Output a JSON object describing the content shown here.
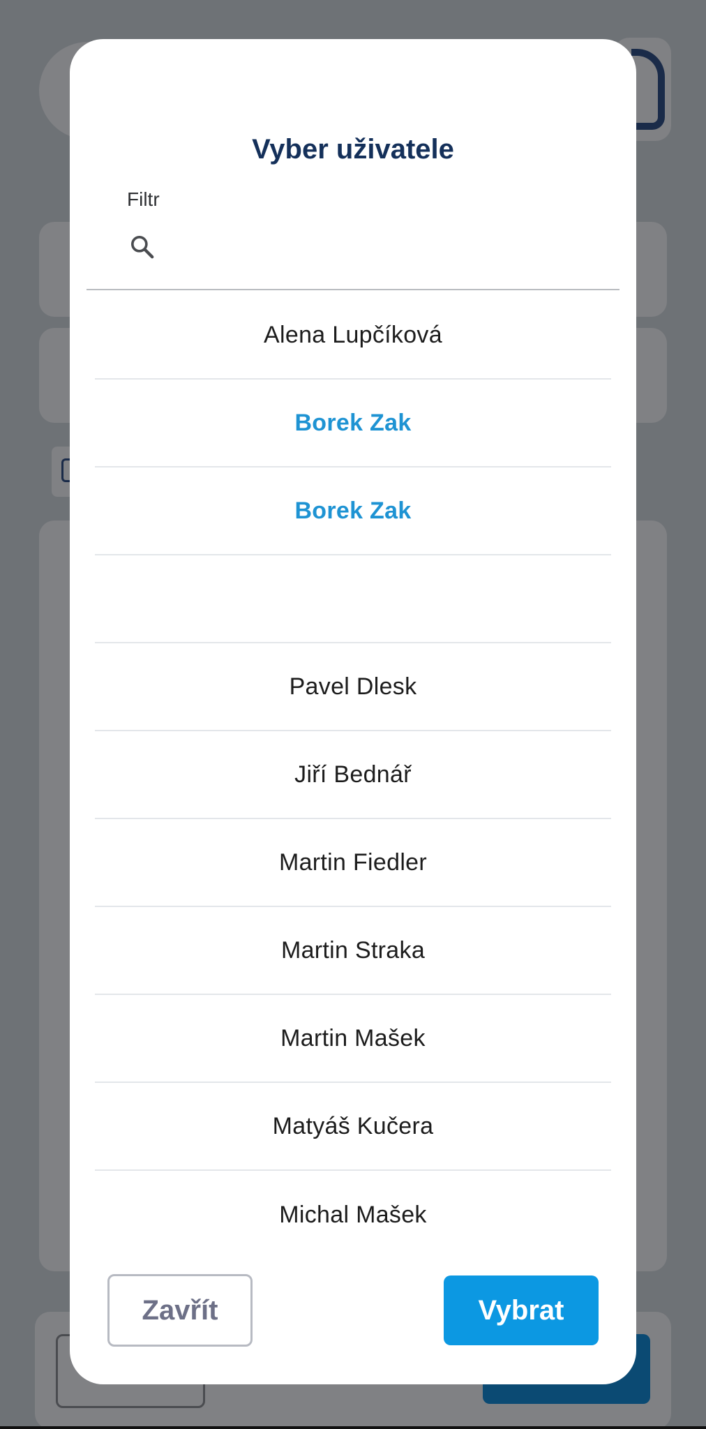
{
  "dialog": {
    "title": "Vyber uživatele",
    "filter_label": "Filtr",
    "filter_value": "",
    "search_icon": "search-icon"
  },
  "users": [
    {
      "name": "Alena Lupčíková",
      "selected": false
    },
    {
      "name": "Borek Zak",
      "selected": true
    },
    {
      "name": "Borek Zak",
      "selected": true
    },
    {
      "name": "",
      "selected": false
    },
    {
      "name": "Pavel Dlesk",
      "selected": false
    },
    {
      "name": "Jiří Bednář",
      "selected": false
    },
    {
      "name": "Martin Fiedler",
      "selected": false
    },
    {
      "name": "Martin Straka",
      "selected": false
    },
    {
      "name": "Martin Mašek",
      "selected": false
    },
    {
      "name": "Matyáš Kučera",
      "selected": false
    },
    {
      "name": "Michal Mašek",
      "selected": false
    }
  ],
  "buttons": {
    "close": "Zavřít",
    "select": "Vybrat"
  },
  "colors": {
    "title": "#14305a",
    "selected_text": "#1e93d3",
    "primary_button": "#0c98e2",
    "overlay": "#6e7276"
  }
}
